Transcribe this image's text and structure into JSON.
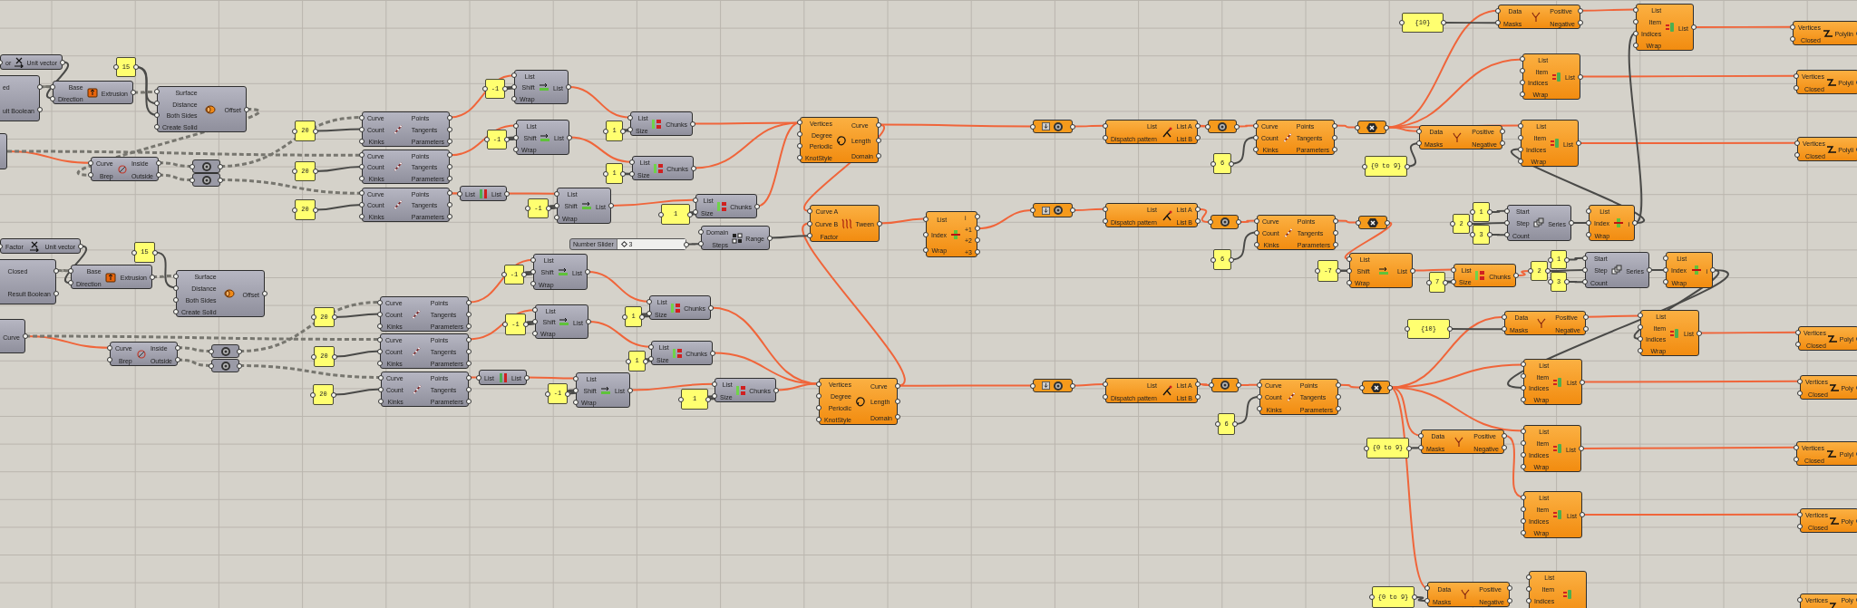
{
  "canvas": {
    "nodes": [
      {
        "kind": "component",
        "selected": false,
        "inputs": [
          "or"
        ],
        "outputs": [
          "Unit vector"
        ]
      },
      {
        "kind": "component",
        "selected": false,
        "outputs": [
          "ed",
          "ult Boolean"
        ]
      },
      {
        "kind": "panel",
        "text": "15"
      },
      {
        "kind": "component",
        "selected": false,
        "inputs": [
          "Base",
          "Direction"
        ],
        "outputs": [
          "Extrusion"
        ]
      },
      {
        "kind": "component",
        "selected": false,
        "inputs": [
          "Surface",
          "Distance",
          "Both Sides",
          "Create Solid"
        ],
        "outputs": [
          "Offset"
        ]
      },
      {
        "kind": "component",
        "selected": false
      },
      {
        "kind": "component",
        "selected": false,
        "inputs": [
          "Curve",
          "Brep"
        ],
        "outputs": [
          "Inside",
          "Outside"
        ]
      },
      {
        "kind": "param",
        "selected": false
      },
      {
        "kind": "param",
        "selected": false
      },
      {
        "kind": "panel",
        "text": "20"
      },
      {
        "kind": "panel",
        "text": "20"
      },
      {
        "kind": "panel",
        "text": "20"
      },
      {
        "kind": "component",
        "selected": false,
        "inputs": [
          "Curve",
          "Count",
          "Kinks"
        ],
        "outputs": [
          "Points",
          "Tangents",
          "Parameters"
        ]
      },
      {
        "kind": "component",
        "selected": false,
        "inputs": [
          "Curve",
          "Count",
          "Kinks"
        ],
        "outputs": [
          "Points",
          "Tangents",
          "Parameters"
        ]
      },
      {
        "kind": "component",
        "selected": false,
        "inputs": [
          "Curve",
          "Count",
          "Kinks"
        ],
        "outputs": [
          "Points",
          "Tangents",
          "Parameters"
        ]
      },
      {
        "kind": "panel",
        "text": "-1"
      },
      {
        "kind": "component",
        "selected": false,
        "inputs": [
          "List",
          "Shift",
          "Wrap"
        ],
        "outputs": [
          "List"
        ]
      },
      {
        "kind": "panel",
        "text": "-1"
      },
      {
        "kind": "component",
        "selected": false,
        "inputs": [
          "List",
          "Shift",
          "Wrap"
        ],
        "outputs": [
          "List"
        ]
      },
      {
        "kind": "component",
        "selected": false,
        "inputs": [
          "List"
        ],
        "outputs": [
          "List"
        ]
      },
      {
        "kind": "panel",
        "text": "-1"
      },
      {
        "kind": "component",
        "selected": false,
        "inputs": [
          "List",
          "Shift",
          "Wrap"
        ],
        "outputs": [
          "List"
        ]
      },
      {
        "kind": "panel",
        "text": "1"
      },
      {
        "kind": "component",
        "selected": false,
        "inputs": [
          "List",
          "Size"
        ],
        "outputs": [
          "Chunks"
        ]
      },
      {
        "kind": "panel",
        "text": "1"
      },
      {
        "kind": "component",
        "selected": false,
        "inputs": [
          "List",
          "Size"
        ],
        "outputs": [
          "Chunks"
        ]
      },
      {
        "kind": "panel",
        "text": "1"
      },
      {
        "kind": "component",
        "selected": false,
        "inputs": [
          "List",
          "Size"
        ],
        "outputs": [
          "Chunks"
        ]
      },
      {
        "kind": "slider",
        "label": "Number Slider",
        "value": "3",
        "level": 0.05
      },
      {
        "kind": "component",
        "selected": false,
        "inputs": [
          "Domain",
          "Steps"
        ],
        "outputs": [
          "Range"
        ]
      },
      {
        "kind": "component",
        "selected": true,
        "inputs": [
          "Vertices",
          "Degree",
          "Periodic",
          "KnotStyle"
        ],
        "outputs": [
          "Curve",
          "Length",
          "Domain"
        ]
      },
      {
        "kind": "component",
        "selected": true,
        "inputs": [
          "Curve A",
          "Curve B",
          "Factor"
        ],
        "outputs": [
          "Tween"
        ]
      },
      {
        "kind": "component",
        "selected": true,
        "inputs": [
          "List",
          "Index",
          "Wrap"
        ],
        "outputs": [
          "i",
          "+1",
          "+2",
          "+3"
        ]
      },
      {
        "kind": "param",
        "selected": true
      },
      {
        "kind": "component",
        "selected": true,
        "inputs": [
          "List",
          "Dispatch pattern"
        ],
        "outputs": [
          "List A",
          "List B"
        ]
      },
      {
        "kind": "param",
        "selected": true
      },
      {
        "kind": "panel",
        "text": "6"
      },
      {
        "kind": "component",
        "selected": true,
        "inputs": [
          "Curve",
          "Count",
          "Kinks"
        ],
        "outputs": [
          "Points",
          "Tangents",
          "Parameters"
        ]
      },
      {
        "kind": "param",
        "selected": true
      },
      {
        "kind": "panel",
        "text": "{10}"
      },
      {
        "kind": "component",
        "selected": true,
        "inputs": [
          "Data",
          "Masks"
        ],
        "outputs": [
          "Positive",
          "Negative"
        ]
      },
      {
        "kind": "component",
        "selected": true,
        "inputs": [
          "List",
          "Item",
          "Indices",
          "Wrap"
        ],
        "outputs": [
          "List"
        ]
      },
      {
        "kind": "component",
        "selected": true,
        "inputs": [
          "Vertices",
          "Closed"
        ],
        "outputs": [
          "Polylin"
        ]
      },
      {
        "kind": "component",
        "selected": true,
        "inputs": [
          "List",
          "Item",
          "Indices",
          "Wrap"
        ],
        "outputs": [
          "List"
        ]
      },
      {
        "kind": "component",
        "selected": true,
        "inputs": [
          "Vertices",
          "Closed"
        ],
        "outputs": [
          "Polyli"
        ]
      },
      {
        "kind": "panel",
        "text": "{0 to 9}"
      },
      {
        "kind": "component",
        "selected": true,
        "inputs": [
          "Data",
          "Masks"
        ],
        "outputs": [
          "Positive",
          "Negative"
        ]
      },
      {
        "kind": "component",
        "selected": true,
        "inputs": [
          "List",
          "Item",
          "Indices",
          "Wrap"
        ],
        "outputs": [
          "List"
        ]
      },
      {
        "kind": "component",
        "selected": true,
        "inputs": [
          "Vertices",
          "Closed"
        ],
        "outputs": [
          "Polyli"
        ]
      },
      {
        "kind": "param",
        "selected": true
      },
      {
        "kind": "component",
        "selected": true,
        "inputs": [
          "List",
          "Dispatch pattern"
        ],
        "outputs": [
          "List A",
          "List B"
        ]
      },
      {
        "kind": "param",
        "selected": true
      },
      {
        "kind": "panel",
        "text": "6"
      },
      {
        "kind": "component",
        "selected": true,
        "inputs": [
          "Curve",
          "Count",
          "Kinks"
        ],
        "outputs": [
          "Points",
          "Tangents",
          "Parameters"
        ]
      },
      {
        "kind": "param",
        "selected": true
      },
      {
        "kind": "panel",
        "text": "1"
      },
      {
        "kind": "panel",
        "text": "2"
      },
      {
        "kind": "panel",
        "text": "3"
      },
      {
        "kind": "component",
        "selected": false,
        "inputs": [
          "Start",
          "Step",
          "Count"
        ],
        "outputs": [
          "Series"
        ]
      },
      {
        "kind": "component",
        "selected": true,
        "inputs": [
          "List",
          "Index",
          "Wrap"
        ],
        "outputs": [
          "i"
        ]
      },
      {
        "kind": "panel",
        "text": "-7"
      },
      {
        "kind": "component",
        "selected": true,
        "inputs": [
          "List",
          "Shift",
          "Wrap"
        ],
        "outputs": [
          "List"
        ]
      },
      {
        "kind": "panel",
        "text": "7"
      },
      {
        "kind": "component",
        "selected": true,
        "inputs": [
          "List",
          "Size"
        ],
        "outputs": [
          "Chunks"
        ]
      },
      {
        "kind": "panel",
        "text": "1"
      },
      {
        "kind": "panel",
        "text": "2"
      },
      {
        "kind": "panel",
        "text": "3"
      },
      {
        "kind": "component",
        "selected": false,
        "inputs": [
          "Start",
          "Step",
          "Count"
        ],
        "outputs": [
          "Series"
        ]
      },
      {
        "kind": "component",
        "selected": true,
        "inputs": [
          "List",
          "Index",
          "Wrap"
        ],
        "outputs": [
          "i"
        ]
      },
      {
        "kind": "component",
        "selected": false,
        "inputs": [
          "Factor"
        ],
        "outputs": [
          "Unit vector"
        ]
      },
      {
        "kind": "panel",
        "text": "15"
      },
      {
        "kind": "component",
        "selected": false,
        "outputs": [
          "Closed",
          "Result Boolean"
        ]
      },
      {
        "kind": "component",
        "selected": false,
        "inputs": [
          "Base",
          "Direction"
        ],
        "outputs": [
          "Extrusion"
        ]
      },
      {
        "kind": "component",
        "selected": false,
        "inputs": [
          "Surface",
          "Distance",
          "Both Sides",
          "Create Solid"
        ],
        "outputs": [
          "Offset"
        ]
      },
      {
        "kind": "panel",
        "text": "-1"
      },
      {
        "kind": "component",
        "selected": false,
        "inputs": [
          "List",
          "Shift",
          "Wrap"
        ],
        "outputs": [
          "List"
        ]
      },
      {
        "kind": "component",
        "selected": false,
        "outputs": [
          "Curve"
        ]
      },
      {
        "kind": "component",
        "selected": false,
        "inputs": [
          "Curve",
          "Brep"
        ],
        "outputs": [
          "Inside",
          "Outside"
        ]
      },
      {
        "kind": "param",
        "selected": false
      },
      {
        "kind": "param",
        "selected": false
      },
      {
        "kind": "panel",
        "text": "20"
      },
      {
        "kind": "component",
        "selected": false,
        "inputs": [
          "Curve",
          "Count",
          "Kinks"
        ],
        "outputs": [
          "Points",
          "Tangents",
          "Parameters"
        ]
      },
      {
        "kind": "panel",
        "text": "20"
      },
      {
        "kind": "component",
        "selected": false,
        "inputs": [
          "Curve",
          "Count",
          "Kinks"
        ],
        "outputs": [
          "Points",
          "Tangents",
          "Parameters"
        ]
      },
      {
        "kind": "panel",
        "text": "20"
      },
      {
        "kind": "component",
        "selected": false,
        "inputs": [
          "Curve",
          "Count",
          "Kinks"
        ],
        "outputs": [
          "Points",
          "Tangents",
          "Parameters"
        ]
      },
      {
        "kind": "panel",
        "text": "-1"
      },
      {
        "kind": "component",
        "selected": false,
        "inputs": [
          "List",
          "Shift",
          "Wrap"
        ],
        "outputs": [
          "List"
        ]
      },
      {
        "kind": "component",
        "selected": false,
        "inputs": [
          "List"
        ],
        "outputs": [
          "List"
        ]
      },
      {
        "kind": "panel",
        "text": "-1"
      },
      {
        "kind": "component",
        "selected": false,
        "inputs": [
          "List",
          "Shift",
          "Wrap"
        ],
        "outputs": [
          "List"
        ]
      },
      {
        "kind": "panel",
        "text": "1"
      },
      {
        "kind": "component",
        "selected": false,
        "inputs": [
          "List",
          "Size"
        ],
        "outputs": [
          "Chunks"
        ]
      },
      {
        "kind": "panel",
        "text": "1"
      },
      {
        "kind": "component",
        "selected": false,
        "inputs": [
          "List",
          "Size"
        ],
        "outputs": [
          "Chunks"
        ]
      },
      {
        "kind": "panel",
        "text": "1"
      },
      {
        "kind": "component",
        "selected": false,
        "inputs": [
          "List",
          "Size"
        ],
        "outputs": [
          "Chunks"
        ]
      },
      {
        "kind": "component",
        "selected": true,
        "inputs": [
          "Vertices",
          "Degree",
          "Periodic",
          "KnotStyle"
        ],
        "outputs": [
          "Curve",
          "Length",
          "Domain"
        ]
      },
      {
        "kind": "param",
        "selected": true
      },
      {
        "kind": "component",
        "selected": true,
        "inputs": [
          "List",
          "Dispatch pattern"
        ],
        "outputs": [
          "List A",
          "List B"
        ]
      },
      {
        "kind": "param",
        "selected": true
      },
      {
        "kind": "panel",
        "text": "6"
      },
      {
        "kind": "component",
        "selected": true,
        "inputs": [
          "Curve",
          "Count",
          "Kinks"
        ],
        "outputs": [
          "Points",
          "Tangents",
          "Parameters"
        ]
      },
      {
        "kind": "param",
        "selected": true
      },
      {
        "kind": "panel",
        "text": "{10}"
      },
      {
        "kind": "component",
        "selected": true,
        "inputs": [
          "Data",
          "Masks"
        ],
        "outputs": [
          "Positive",
          "Negative"
        ]
      },
      {
        "kind": "component",
        "selected": true,
        "inputs": [
          "List",
          "Item",
          "Indices",
          "Wrap"
        ],
        "outputs": [
          "List"
        ]
      },
      {
        "kind": "component",
        "selected": true,
        "inputs": [
          "Vertices",
          "Closed"
        ],
        "outputs": [
          "Polyl"
        ]
      },
      {
        "kind": "component",
        "selected": true,
        "inputs": [
          "List",
          "Item",
          "Indices",
          "Wrap"
        ],
        "outputs": [
          "List"
        ]
      },
      {
        "kind": "component",
        "selected": true,
        "inputs": [
          "Vertices",
          "Closed"
        ],
        "outputs": [
          "Poly"
        ]
      },
      {
        "kind": "panel",
        "text": "{0 to 9}"
      },
      {
        "kind": "component",
        "selected": true,
        "inputs": [
          "Data",
          "Masks"
        ],
        "outputs": [
          "Positive",
          "Negative"
        ]
      },
      {
        "kind": "component",
        "selected": true,
        "inputs": [
          "List",
          "Item",
          "Indices",
          "Wrap"
        ],
        "outputs": [
          "List"
        ]
      },
      {
        "kind": "component",
        "selected": true,
        "inputs": [
          "Vertices",
          "Closed"
        ],
        "outputs": [
          "Polyl"
        ]
      },
      {
        "kind": "component",
        "selected": true,
        "inputs": [
          "List",
          "Item",
          "Indices",
          "Wrap"
        ],
        "outputs": [
          "List"
        ]
      },
      {
        "kind": "component",
        "selected": true,
        "inputs": [
          "Vertices",
          "Closed"
        ],
        "outputs": [
          "Poly"
        ]
      },
      {
        "kind": "panel",
        "text": "{0 to 9}"
      },
      {
        "kind": "component",
        "selected": true,
        "inputs": [
          "Data",
          "Masks"
        ],
        "outputs": [
          "Positive",
          "Negative"
        ]
      },
      {
        "kind": "component",
        "selected": true,
        "inputs": [
          "List",
          "Item",
          "Indices"
        ]
      },
      {
        "kind": "component",
        "selected": true,
        "inputs": [
          "Vertices"
        ],
        "outputs": [
          "Poly"
        ]
      }
    ]
  }
}
